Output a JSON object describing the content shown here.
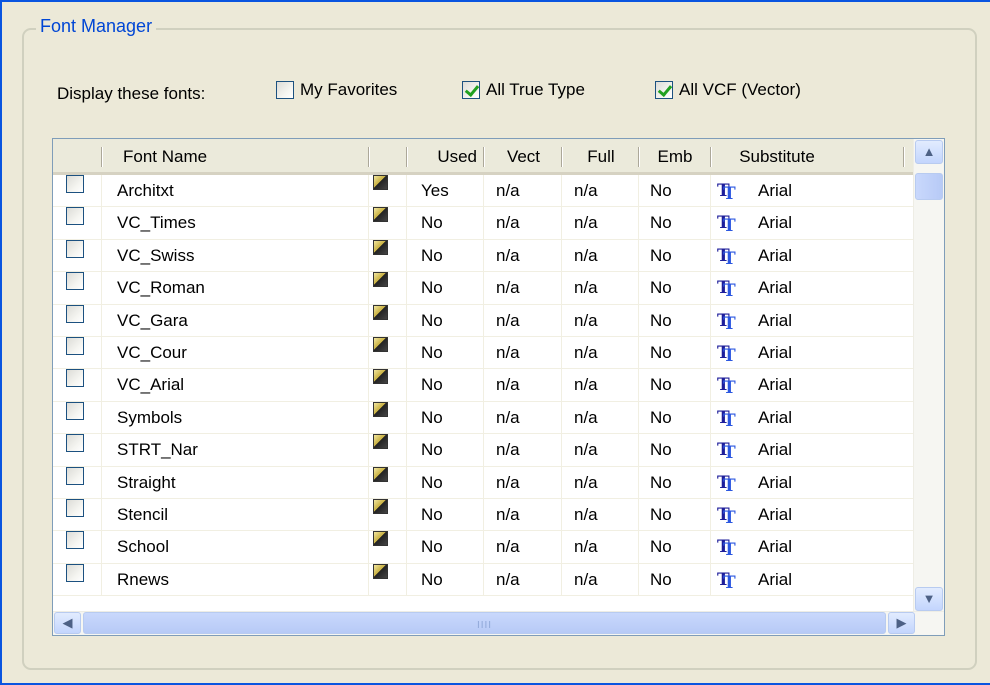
{
  "group": {
    "title": "Font Manager"
  },
  "filter": {
    "label": "Display these fonts:",
    "options": [
      {
        "label": "My Favorites",
        "checked": false
      },
      {
        "label": "All True Type",
        "checked": true
      },
      {
        "label": "All VCF (Vector)",
        "checked": true
      }
    ]
  },
  "grid": {
    "columns": [
      "Font Name",
      "",
      "Used",
      "Vect",
      "Full",
      "Emb",
      "Substitute"
    ],
    "rows": [
      {
        "name": "Architxt",
        "used": "Yes",
        "vect": "n/a",
        "full": "n/a",
        "emb": "No",
        "substitute": "Arial"
      },
      {
        "name": "VC_Times",
        "used": "No",
        "vect": "n/a",
        "full": "n/a",
        "emb": "No",
        "substitute": "Arial"
      },
      {
        "name": "VC_Swiss",
        "used": "No",
        "vect": "n/a",
        "full": "n/a",
        "emb": "No",
        "substitute": "Arial"
      },
      {
        "name": "VC_Roman",
        "used": "No",
        "vect": "n/a",
        "full": "n/a",
        "emb": "No",
        "substitute": "Arial"
      },
      {
        "name": "VC_Gara",
        "used": "No",
        "vect": "n/a",
        "full": "n/a",
        "emb": "No",
        "substitute": "Arial"
      },
      {
        "name": "VC_Cour",
        "used": "No",
        "vect": "n/a",
        "full": "n/a",
        "emb": "No",
        "substitute": "Arial"
      },
      {
        "name": "VC_Arial",
        "used": "No",
        "vect": "n/a",
        "full": "n/a",
        "emb": "No",
        "substitute": "Arial"
      },
      {
        "name": "Symbols",
        "used": "No",
        "vect": "n/a",
        "full": "n/a",
        "emb": "No",
        "substitute": "Arial"
      },
      {
        "name": "STRT_Nar",
        "used": "No",
        "vect": "n/a",
        "full": "n/a",
        "emb": "No",
        "substitute": "Arial"
      },
      {
        "name": "Straight",
        "used": "No",
        "vect": "n/a",
        "full": "n/a",
        "emb": "No",
        "substitute": "Arial"
      },
      {
        "name": "Stencil",
        "used": "No",
        "vect": "n/a",
        "full": "n/a",
        "emb": "No",
        "substitute": "Arial"
      },
      {
        "name": "School",
        "used": "No",
        "vect": "n/a",
        "full": "n/a",
        "emb": "No",
        "substitute": "Arial"
      },
      {
        "name": "Rnews",
        "used": "No",
        "vect": "n/a",
        "full": "n/a",
        "emb": "No",
        "substitute": "Arial"
      }
    ]
  },
  "icons": {
    "vector_font": "vector-font-icon",
    "truetype_font": "truetype-font-icon",
    "scroll_up": "▲",
    "scroll_down": "▼",
    "scroll_left": "◀",
    "scroll_right": "▶",
    "grip": "IIII"
  },
  "colors": {
    "title": "#0046D5",
    "accent": "#0A55E0",
    "check": "#21A121",
    "panel": "#ECE9D8"
  }
}
